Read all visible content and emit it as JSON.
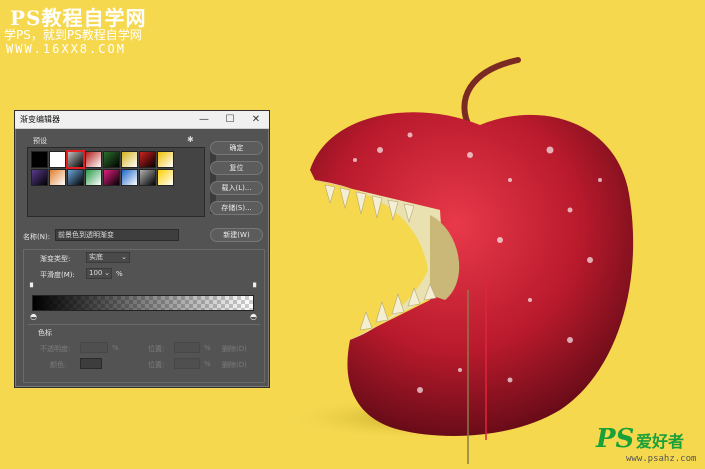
{
  "watermark": {
    "title": "PS教程自学网",
    "subtitle": "学PS，就到PS教程自学网",
    "url": "WWW.16XX8.COM"
  },
  "dialog": {
    "title": "渐变编辑器",
    "presets_label": "预设",
    "buttons": {
      "ok": "确定",
      "reset": "复位",
      "load": "载入(L)...",
      "save": "存储(S)...",
      "new": "新建(W)"
    },
    "name_label": "名称(N):",
    "name_value": "前景色到透明渐变",
    "gradient_type_label": "渐变类型:",
    "gradient_type_value": "实底",
    "smoothness_label": "平滑度(M):",
    "smoothness_value": "100",
    "smoothness_unit": "%",
    "stops_group_label": "色标",
    "opacity_label": "不透明度:",
    "opacity_unit": "%",
    "location_label": "位置:",
    "location_unit": "%",
    "delete_label": "删除(D)",
    "color_label": "颜色:",
    "swatch_colors": [
      "#000000",
      "#ffffff",
      "#c0c0c0",
      "#b41e1e",
      "#2b6f2b",
      "#d4b21c",
      "#d02020",
      "#f0c000",
      "#5a3b8c",
      "#e08030",
      "#6da4d8",
      "#2a9a4a",
      "#e02080",
      "#1f66c9",
      "#b0b0b0",
      "#ffd000"
    ]
  },
  "bottom_watermark": {
    "logo": "PS",
    "name": "爱好者",
    "url": "www.psahz.com"
  }
}
